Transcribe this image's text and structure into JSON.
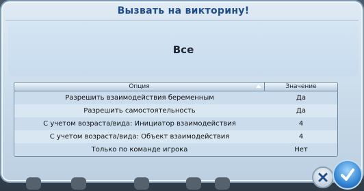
{
  "dialog": {
    "title": "Вызвать на викторину!",
    "heading": "Все"
  },
  "table": {
    "col_option": "Опция",
    "col_value": "Значение",
    "rows": [
      {
        "option": "Разрешить взаимодействия беременным",
        "value": "Да"
      },
      {
        "option": "Разрешить самостоятельность",
        "value": "Да"
      },
      {
        "option": "С учетом возраста/вида: Инициатор взаимодействия",
        "value": "4"
      },
      {
        "option": "С учетом возраста/вида: Объект взаимодействия",
        "value": "4"
      },
      {
        "option": "Только по команде игрока",
        "value": "Нет"
      }
    ]
  },
  "icons": {
    "sort": "sort-ascending-icon",
    "cancel": "close-icon",
    "ok": "checkmark-icon"
  },
  "colors": {
    "title": "#1f4d8a",
    "ok_button": "#2e7fd0"
  }
}
